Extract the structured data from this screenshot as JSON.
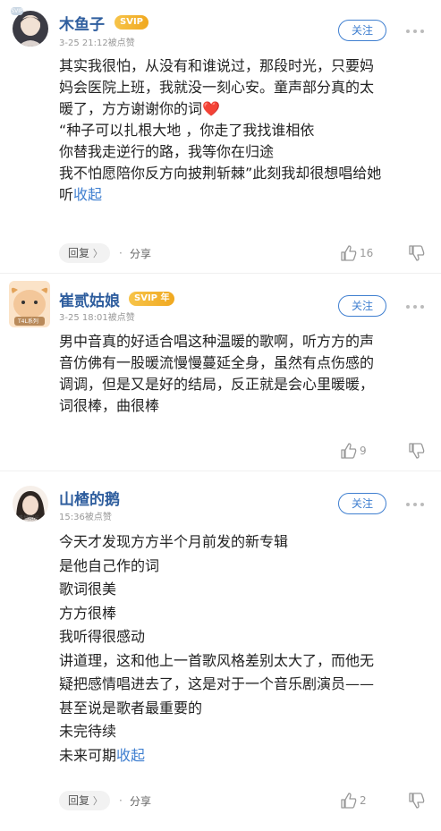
{
  "comments": [
    {
      "username": "木鱼子",
      "badge": "SVIP",
      "avatar_badge": "SVIP",
      "meta": "3-25 21:12被点赞",
      "follow_label": "关注",
      "lines": [
        "其实我很怕，从没有和谁说过，那段时光，只要妈",
        "妈会医院上班，我就没一刻心安。童声部分真的太",
        "暖了，方方谢谢你的词",
        "“种子可以扎根大地 ，你走了我找谁相依",
        "你替我走逆行的路，我等你在归途",
        "我不怕愿陪你反方向披荆斩棘”此刻我却很想唱给她",
        "听"
      ],
      "heart": "❤️",
      "collapse_label": "收起",
      "reply_label": "回复",
      "share_label": "分享",
      "like_count": "16"
    },
    {
      "username": "崔贰姑娘",
      "badge": "SVIP 年",
      "avatar_text": "T4L系列",
      "meta": "3-25 18:01被点赞",
      "follow_label": "关注",
      "lines": [
        "男中音真的好适合唱这种温暖的歌啊，听方方的声",
        "音仿佛有一股暖流慢慢蔓延全身，虽然有点伤感的",
        "调调，但是又是好的结局，反正就是会心里暖暖，",
        "词很棒，曲很棒"
      ],
      "like_count": "9"
    },
    {
      "username": "山楂的鹅",
      "avatar_text": "盛世阳光",
      "meta": "15:36被点赞",
      "follow_label": "关注",
      "lines": [
        "今天才发现方方半个月前发的新专辑",
        "是他自己作的词",
        "歌词很美",
        "方方很棒",
        "我听得很感动",
        "讲道理，这和他上一首歌风格差别太大了，而他无",
        "疑把感情唱进去了，这是对于一个音乐剧演员——",
        "甚至说是歌者最重要的",
        "未完待续",
        "未来可期"
      ],
      "collapse_label": "收起",
      "reply_label": "回复",
      "share_label": "分享",
      "like_count": "2"
    }
  ],
  "colors": {
    "username": "#2f5e9e",
    "link": "#3f7fd0",
    "svip": "#f0a81f",
    "meta": "#999999"
  },
  "icons": [
    "more-icon",
    "thumb-up-icon",
    "thumb-down-icon",
    "chevron-right-icon"
  ]
}
